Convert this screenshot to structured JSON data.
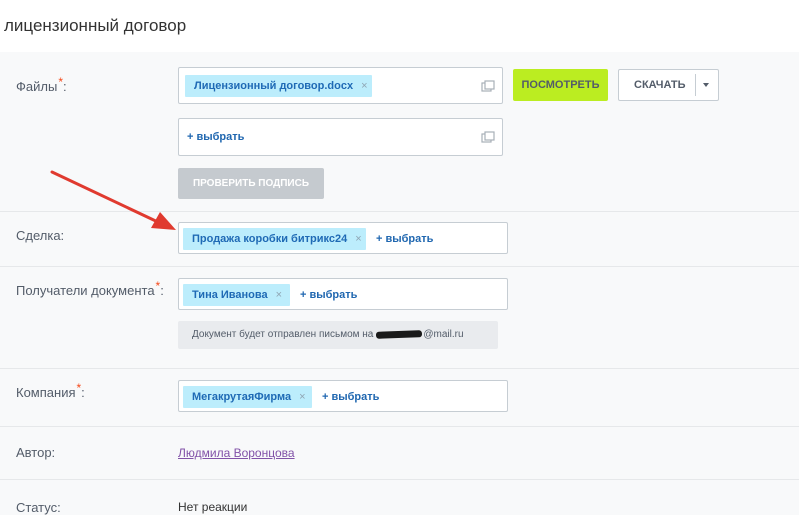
{
  "header": {
    "title": "лицензионный договор"
  },
  "files": {
    "label": "Файлы",
    "required_mark": "*",
    "attached": [
      {
        "name": "Лицензионный договор.docx",
        "remove": "×"
      }
    ],
    "add_label": "+ выбрать",
    "view_button": "ПОСМОТРЕТЬ",
    "download_button": "СКАЧАТЬ",
    "check_signature_button": "ПРОВЕРИТЬ ПОДПИСЬ"
  },
  "deal": {
    "label": "Сделка:",
    "tag": "Продажа коробки битрикс24",
    "remove": "×",
    "add_label": "+ выбрать"
  },
  "recipients": {
    "label": "Получатели документа",
    "required_mark": "*",
    "tag": "Тина Иванова",
    "remove": "×",
    "add_label": "+ выбрать",
    "note_prefix": "Документ будет отправлен письмом на",
    "note_suffix": "@mail.ru"
  },
  "company": {
    "label": "Компания",
    "required_mark": "*",
    "tag": "МегакрутаяФирма",
    "remove": "×",
    "add_label": "+ выбрать"
  },
  "author": {
    "label": "Автор:",
    "value": "Людмила Воронцова"
  },
  "status": {
    "label": "Статус:",
    "value": "Нет реакции"
  },
  "colors": {
    "accent_green": "#bbed21",
    "tag_background": "#bcedfc",
    "link_blue": "#2067b0",
    "annotation_arrow": "#e03a2f"
  }
}
